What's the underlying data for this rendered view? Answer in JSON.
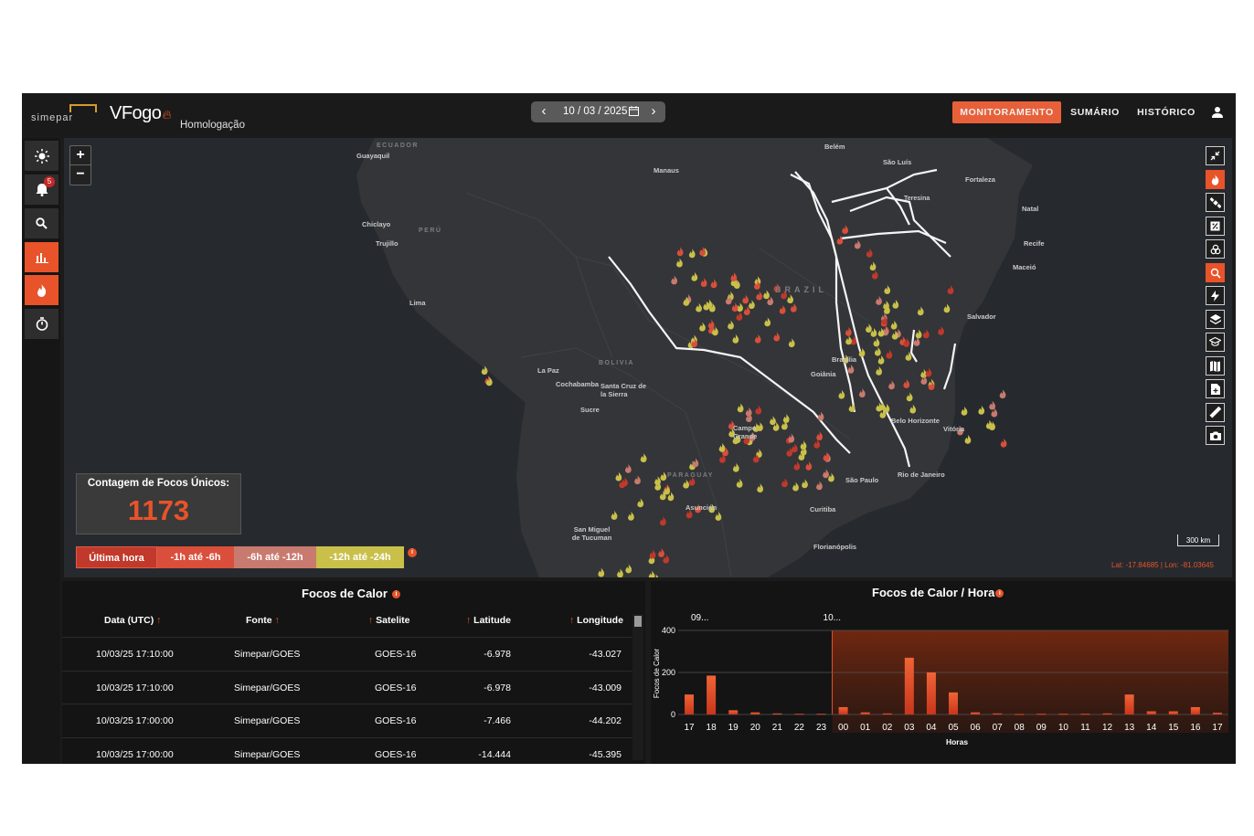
{
  "header": {
    "brand_simepar": "simepar",
    "brand_app": "VFogo",
    "environment": "Homologação",
    "date": "10 / 03 / 2025",
    "prev_arrow": "‹",
    "next_arrow": "›",
    "nav": [
      {
        "label": "MONITORAMENTO",
        "active": true
      },
      {
        "label": "SUMÁRIO",
        "active": false
      },
      {
        "label": "HISTÓRICO",
        "active": false
      }
    ]
  },
  "sidebar": {
    "items": [
      {
        "icon": "sun-icon",
        "active": false
      },
      {
        "icon": "bell-icon",
        "active": false,
        "badge": "5"
      },
      {
        "icon": "search-icon",
        "active": false
      },
      {
        "icon": "bar-chart-icon",
        "active": true
      },
      {
        "icon": "fire-icon",
        "active": true
      },
      {
        "icon": "timer-icon",
        "active": false
      }
    ]
  },
  "map": {
    "zoom_in": "+",
    "zoom_out": "−",
    "places": [
      "Belém",
      "Manaus",
      "São Luís",
      "Fortaleza",
      "Teresina",
      "Natal",
      "Recife",
      "Maceió",
      "Salvador",
      "Guayaquil",
      "Chiclayo",
      "Trujillo",
      "Lima",
      "La Paz",
      "Cochabamba",
      "Santa Cruz de la Sierra",
      "Sucre",
      "Brasília",
      "Goiânia",
      "Campo Grande",
      "Belo Horizonte",
      "Vitória",
      "São Paulo",
      "Rio de Janeiro",
      "Curitiba",
      "Florianópolis",
      "Asunción",
      "San Miguel de Tucuman"
    ],
    "countries": [
      "ECUADOR",
      "PERÚ",
      "BOLIVIA",
      "BRAZIL",
      "PARAGUAY"
    ],
    "count_title": "Contagem de Focos Únicos:",
    "count_value": "1173",
    "legend": [
      "Última hora",
      "-1h até -6h",
      "-6h até -12h",
      "-12h até -24h"
    ],
    "legend_colors": [
      "#c0392b",
      "#d94f3b",
      "#c97a6e",
      "#c9c04a"
    ],
    "scale_label": "300 km",
    "coords": "Lat: -17.84685 | Lon: -81.03645",
    "right_tools": [
      "collapse-icon",
      "fire-layer-icon",
      "satellite-icon",
      "percent-icon",
      "biohazard-icon",
      "search-map-icon",
      "lightning-icon",
      "layers-icon",
      "school-icon",
      "map-book-icon",
      "file-icon",
      "ruler-icon",
      "camera-icon"
    ]
  },
  "table": {
    "title": "Focos de Calor",
    "columns": [
      "Data (UTC)",
      "Fonte",
      "Satelite",
      "Latitude",
      "Longitude"
    ],
    "rows": [
      [
        "10/03/25 17:10:00",
        "Simepar/GOES",
        "GOES-16",
        "-6.978",
        "-43.027"
      ],
      [
        "10/03/25 17:10:00",
        "Simepar/GOES",
        "GOES-16",
        "-6.978",
        "-43.009"
      ],
      [
        "10/03/25 17:00:00",
        "Simepar/GOES",
        "GOES-16",
        "-7.466",
        "-44.202"
      ],
      [
        "10/03/25 17:00:00",
        "Simepar/GOES",
        "GOES-16",
        "-14.444",
        "-45.395"
      ]
    ]
  },
  "chart": {
    "title": "Focos de Calor / Hora"
  },
  "chart_data": {
    "type": "bar",
    "title": "Focos de Calor / Hora",
    "xlabel": "Horas",
    "ylabel": "Focos de Calor",
    "ylim": [
      0,
      400
    ],
    "yticks": [
      0,
      200,
      400
    ],
    "day_labels": [
      "09...",
      "10..."
    ],
    "categories": [
      "17",
      "18",
      "19",
      "20",
      "21",
      "22",
      "23",
      "00",
      "01",
      "02",
      "03",
      "04",
      "05",
      "06",
      "07",
      "08",
      "09",
      "10",
      "11",
      "12",
      "13",
      "14",
      "15",
      "16",
      "17"
    ],
    "values": [
      95,
      185,
      20,
      10,
      5,
      3,
      3,
      35,
      10,
      5,
      270,
      200,
      105,
      10,
      5,
      2,
      3,
      3,
      3,
      5,
      95,
      15,
      15,
      35,
      8
    ],
    "grid": true,
    "bar_color": "#e8532a"
  }
}
